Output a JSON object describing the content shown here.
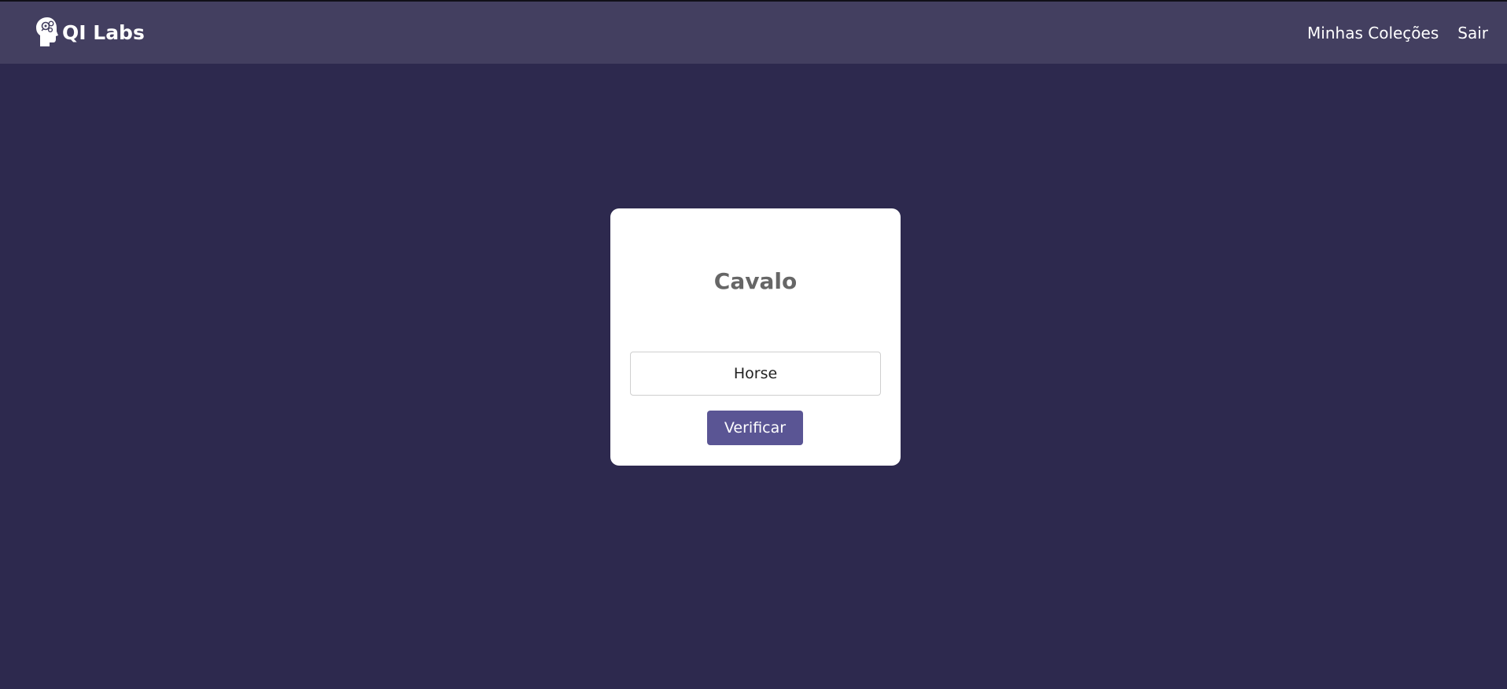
{
  "navbar": {
    "brand_name": "QI Labs",
    "brand_icon": "brain-head-icon",
    "links": [
      {
        "label": "Minhas Coleções"
      },
      {
        "label": "Sair"
      }
    ]
  },
  "flashcard": {
    "word": "Cavalo",
    "answer_value": "Horse",
    "answer_placeholder": "",
    "verify_label": "Verificar"
  },
  "colors": {
    "background": "#2d294e",
    "navbar": "#433f60",
    "card": "#ffffff",
    "button": "#5a5594",
    "title_text": "#666666"
  }
}
